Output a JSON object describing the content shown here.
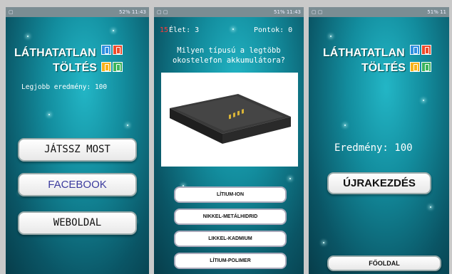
{
  "screens": {
    "menu": {
      "status_time": "52% 11:43",
      "logo_line1": "LÁTHATATLAN",
      "logo_line2": "TÖLTÉS",
      "best_score": "Legjobb eredmény: 100",
      "play_button": "JÁTSSZ MOST",
      "facebook_button": "FACEBOOK",
      "website_button": "WEBOLDAL"
    },
    "quiz": {
      "status_time": "51% 11:43",
      "timer": "15",
      "lives": "Élet: 3",
      "points": "Pontok: 0",
      "question": "Milyen típusú a legtöbb okostelefon akkumulátora?",
      "answers": [
        "LÍTIUM-ION",
        "NIKKEL-METÁLHIDRID",
        "LIKKEL-KADMIUM",
        "LÍTIUM-POLIMER"
      ]
    },
    "result": {
      "status_time": "51% 11",
      "logo_line1": "LÁTHATATLAN",
      "logo_line2": "TÖLTÉS",
      "score": "Eredmény: 100",
      "restart_button": "ÚJRAKEZDÉS",
      "home_button": "FŐOLDAL"
    }
  },
  "colors": {
    "tile_blue": "#2f8fe0",
    "tile_red": "#ef4b2b",
    "tile_yellow": "#f6b21a",
    "tile_green": "#3db55c",
    "facebook_text": "#3b3b9e",
    "timer_red": "#ff3a3a"
  },
  "icons": [
    "battery-icon",
    "wifi-icon",
    "signal-icon",
    "battery-image"
  ]
}
